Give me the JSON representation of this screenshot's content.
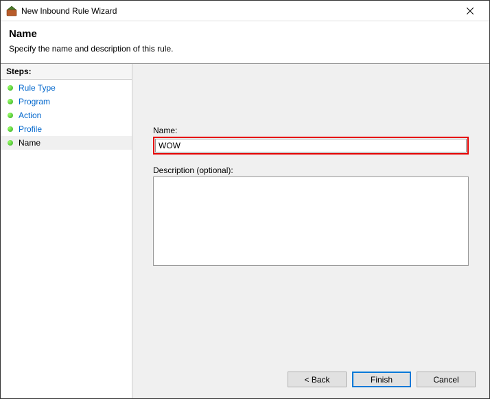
{
  "window": {
    "title": "New Inbound Rule Wizard"
  },
  "header": {
    "title": "Name",
    "subtitle": "Specify the name and description of this rule."
  },
  "sidebar": {
    "title": "Steps:",
    "items": [
      {
        "label": "Rule Type"
      },
      {
        "label": "Program"
      },
      {
        "label": "Action"
      },
      {
        "label": "Profile"
      },
      {
        "label": "Name"
      }
    ]
  },
  "form": {
    "name_label": "Name:",
    "name_value": "WOW",
    "desc_label": "Description (optional):",
    "desc_value": ""
  },
  "buttons": {
    "back": "< Back",
    "finish": "Finish",
    "cancel": "Cancel"
  }
}
